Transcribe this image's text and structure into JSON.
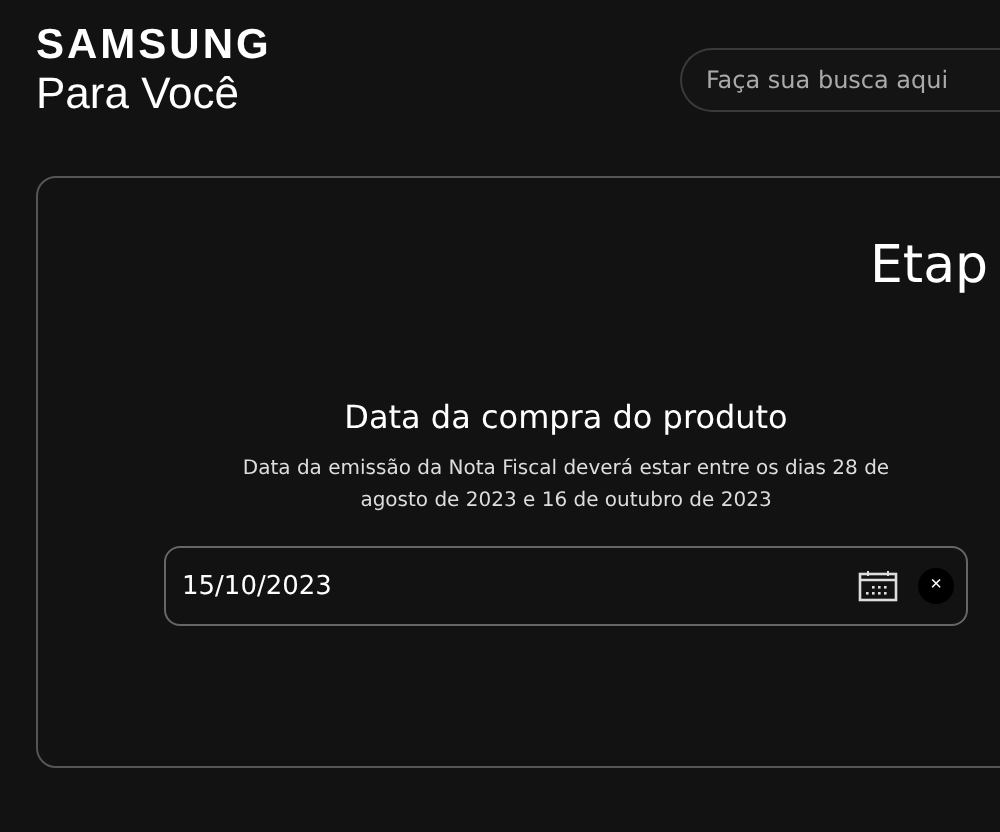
{
  "header": {
    "brand": "SAMSUNG",
    "subtitle": "Para Você",
    "search": {
      "placeholder": "Faça sua busca aqui"
    }
  },
  "card": {
    "step_title": "Etap",
    "heading": "Data da compra do produto",
    "description": "Data da emissão da Nota Fiscal deverá estar entre os dias 28 de agosto de 2023 e 16 de outubro de 2023",
    "date_field": {
      "value": "15/10/2023"
    },
    "clear_button": "×"
  }
}
